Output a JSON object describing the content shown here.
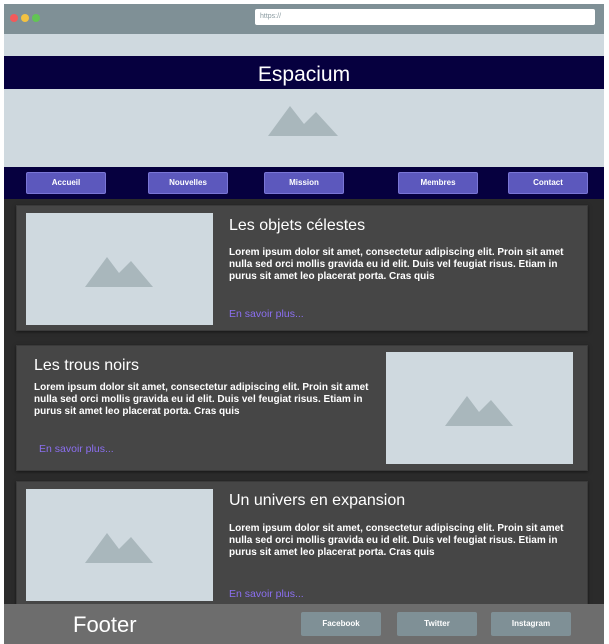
{
  "browser": {
    "url": "https://"
  },
  "header": {
    "site_title": "Espacium"
  },
  "nav": {
    "items": [
      "Accueil",
      "Nouvelles",
      "Mission",
      "Membres",
      "Contact"
    ]
  },
  "articles": [
    {
      "title": "Les objets célestes",
      "body": "Lorem ipsum dolor sit amet, consectetur adipiscing elit. Proin sit amet nulla sed orci mollis gravida eu id elit. Duis vel feugiat risus. Etiam in purus sit amet leo placerat porta. Cras quis",
      "link": "En savoir plus..."
    },
    {
      "title": "Les trous noirs",
      "body": "Lorem ipsum dolor sit amet, consectetur adipiscing elit. Proin sit amet nulla sed orci mollis gravida eu id elit. Duis vel feugiat risus. Etiam in purus sit amet leo placerat porta. Cras quis",
      "link": "En savoir plus..."
    },
    {
      "title": "Un univers en expansion",
      "body": "Lorem ipsum dolor sit amet, consectetur adipiscing elit. Proin sit amet nulla sed orci mollis gravida eu id elit. Duis vel feugiat risus. Etiam in purus sit amet leo placerat porta. Cras quis",
      "link": "En savoir plus..."
    }
  ],
  "footer": {
    "label": "Footer",
    "social": [
      "Facebook",
      "Twitter",
      "Instagram"
    ]
  },
  "colors": {
    "header_bg": "#06003f",
    "nav_button": "#5c58bd",
    "link": "#8b6ff0",
    "placeholder": "#cfd9df",
    "card_bg": "#464646"
  }
}
